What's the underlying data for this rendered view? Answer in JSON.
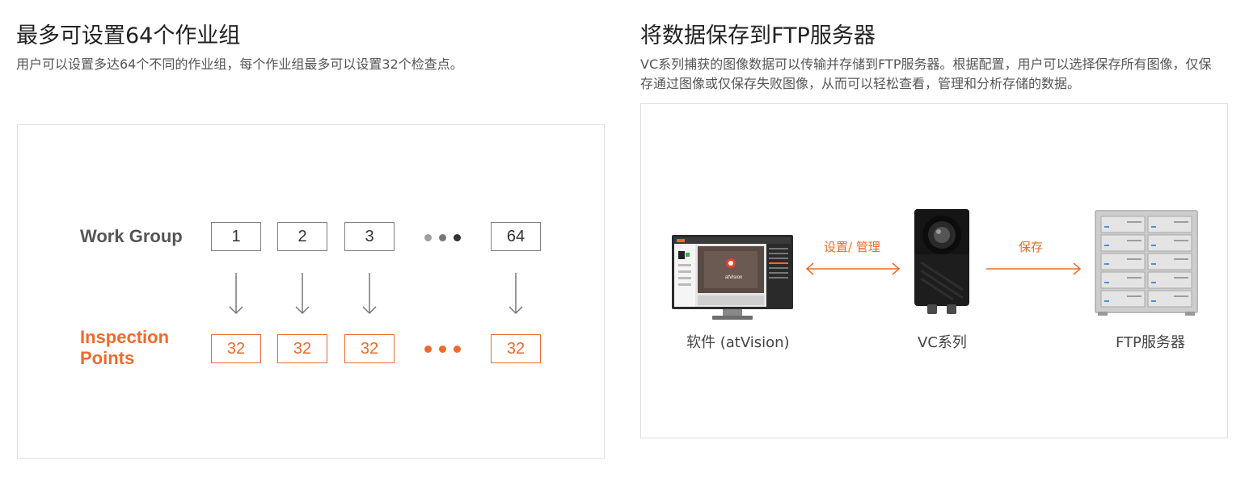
{
  "left": {
    "title": "最多可设置64个作业组",
    "description": "用户可以设置多达64个不同的作业组，每个作业组最多可以设置32个检查点。",
    "diagram": {
      "work_group_label": "Work Group",
      "inspection_label_line1": "Inspection",
      "inspection_label_line2": "Points",
      "groups": [
        "1",
        "2",
        "3",
        "64"
      ],
      "points": [
        "32",
        "32",
        "32",
        "32"
      ],
      "gray_color": "#808080",
      "accent_color": "#ef6a2a"
    }
  },
  "right": {
    "title": "将数据保存到FTP服务器",
    "description": "VC系列捕获的图像数据可以传输并存储到FTP服务器。根据配置，用户可以选择保存所有图像，仅保存通过图像或仅保存失败图像，从而可以轻松查看，管理和分析存储的数据。",
    "diagram": {
      "software_caption": "软件 (atVision)",
      "camera_caption": "VC系列",
      "server_caption": "FTP服务器",
      "setup_manage_label": "设置/ 管理",
      "save_label": "保存",
      "monitor_screen_text": "atVision"
    }
  }
}
